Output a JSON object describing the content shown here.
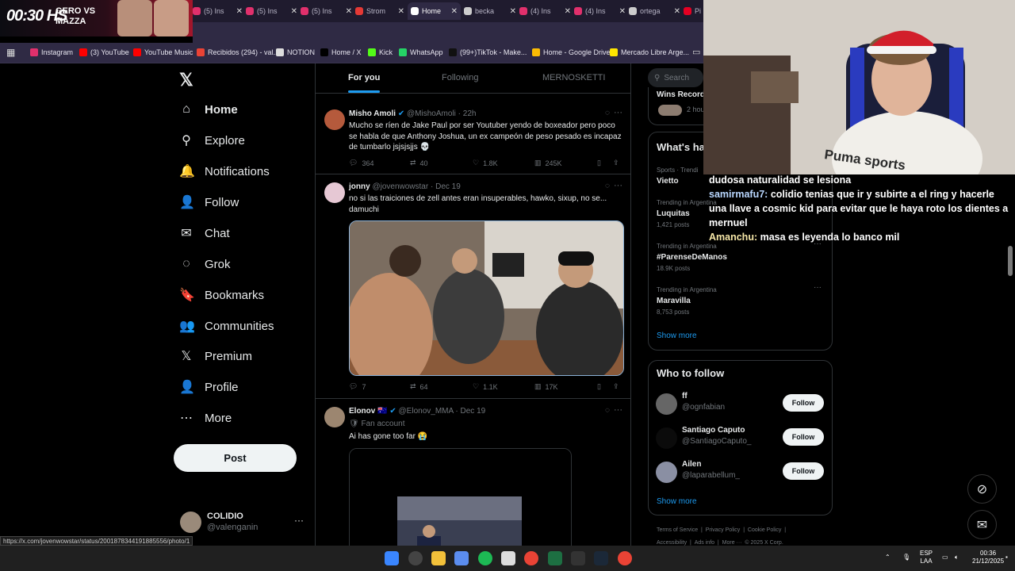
{
  "promo": {
    "clock": "00:30 HS",
    "line1": "GERO VS",
    "line2": "MAZZA"
  },
  "tabs": [
    {
      "label": "(5) Ins",
      "color": "#e1306c"
    },
    {
      "label": "(5) Ins",
      "color": "#e1306c"
    },
    {
      "label": "(5) Ins",
      "color": "#e1306c"
    },
    {
      "label": "Strom",
      "color": "#e53935"
    },
    {
      "label": "Home",
      "color": "#ffffff",
      "active": true
    },
    {
      "label": "becka",
      "color": "#cccccc"
    },
    {
      "label": "(4) Ins",
      "color": "#e1306c"
    },
    {
      "label": "(4) Ins",
      "color": "#e1306c"
    },
    {
      "label": "ortega",
      "color": "#cccccc"
    },
    {
      "label": "Pi",
      "color": "#e60023"
    }
  ],
  "bookmarks": [
    {
      "label": "Instagram",
      "color": "#e1306c"
    },
    {
      "label": "(3) YouTube",
      "color": "#ff0000"
    },
    {
      "label": "YouTube Music",
      "color": "#ff0000"
    },
    {
      "label": "Recibidos (294) - val...",
      "color": "#ea4335"
    },
    {
      "label": "NOTION",
      "color": "#dddddd"
    },
    {
      "label": "Home / X",
      "color": "#000000"
    },
    {
      "label": "Kick",
      "color": "#53fc18"
    },
    {
      "label": "WhatsApp",
      "color": "#25d366"
    },
    {
      "label": "(99+)TikTok - Make...",
      "color": "#111111"
    },
    {
      "label": "Home - Google Drive",
      "color": "#fbbc04"
    },
    {
      "label": "Mercado Libre Arge...",
      "color": "#ffe600"
    }
  ],
  "x_logo": "𝕏",
  "nav": [
    {
      "label": "Home",
      "icon": "house-icon",
      "glyph": "⌂"
    },
    {
      "label": "Explore",
      "icon": "search-icon",
      "glyph": "⚲"
    },
    {
      "label": "Notifications",
      "icon": "bell-icon",
      "glyph": "🔔"
    },
    {
      "label": "Follow",
      "icon": "person-plus-icon",
      "glyph": "👤"
    },
    {
      "label": "Chat",
      "icon": "mail-icon",
      "glyph": "✉"
    },
    {
      "label": "Grok",
      "icon": "grok-icon",
      "glyph": "◌"
    },
    {
      "label": "Bookmarks",
      "icon": "bookmark-icon",
      "glyph": "🔖"
    },
    {
      "label": "Communities",
      "icon": "communities-icon",
      "glyph": "👥"
    },
    {
      "label": "Premium",
      "icon": "x-premium-icon",
      "glyph": "𝕏"
    },
    {
      "label": "Profile",
      "icon": "profile-icon",
      "glyph": "👤"
    },
    {
      "label": "More",
      "icon": "more-icon",
      "glyph": "⋯"
    }
  ],
  "post_label": "Post",
  "account": {
    "name": "COLIDIO",
    "handle": "@valenganin",
    "dots": "···"
  },
  "status_url": "https://x.com/jovenwowstar/status/2001878344191885556/photo/1",
  "feed_tabs": [
    "For you",
    "Following",
    "MERNOSKETTI"
  ],
  "tweets": [
    {
      "name": "Misho Amoli",
      "verified": "✔",
      "handle": "@MishoAmoli",
      "time": "22h",
      "text": "Mucho se ríen de Jake Paul por ser Youtuber yendo de boxeador pero poco se habla de que Anthony Joshua, un ex campeón de peso pesado es incapaz de tumbarlo jsjsjsjjs 💀",
      "replies": "364",
      "reposts": "40",
      "likes": "1.8K",
      "views": "245K"
    },
    {
      "name": "jonny",
      "handle": "@jovenwowstar",
      "time": "Dec 19",
      "text": "no si las traiciones de zell antes eran insuperables, hawko, sixup, no se... damuchi",
      "replies": "7",
      "reposts": "64",
      "likes": "1.1K",
      "views": "17K"
    },
    {
      "name": "Elonov",
      "flag": "🇦🇺",
      "verified": "✔",
      "handle": "@Elonov_MMA",
      "time": "Dec 19",
      "badge": "🛡 Fan account",
      "text": "Ai has gone too far 😭"
    }
  ],
  "search_placeholder": "Search",
  "wins_record": {
    "label": "Wins Record",
    "time": "2 hou"
  },
  "whats_happening": "What's ha",
  "trends": [
    {
      "category": "Sports · Trendi",
      "name": "Vietto",
      "posts": ""
    },
    {
      "category": "Trending in Argentina",
      "name": "Luquitas",
      "posts": "1,421 posts"
    },
    {
      "category": "Trending in Argentina",
      "name": "#ParenseDeManos",
      "posts": "18.9K posts"
    },
    {
      "category": "Trending in Argentina",
      "name": "Maravilla",
      "posts": "8,753 posts"
    }
  ],
  "show_more": "Show more",
  "who_to_follow": "Who to follow",
  "suggestions": [
    {
      "name": "ff",
      "handle": "@ognfabian",
      "btn": "Follow"
    },
    {
      "name": "Santiago Caputo",
      "handle": "@SantiagoCaputo_",
      "btn": "Follow"
    },
    {
      "name": "Ailen",
      "handle": "@laparabellum_",
      "btn": "Follow"
    }
  ],
  "footer1": [
    "Terms of Service",
    "|",
    "Privacy Policy",
    "|",
    "Cookie Policy",
    "|"
  ],
  "footer2": [
    "Accessibility",
    "|",
    "Ads info",
    "|",
    "More ···",
    "© 2025 X Corp."
  ],
  "chat": [
    {
      "user": "",
      "msg": "dudosa naturalidad se lesiona"
    },
    {
      "user": "samirmafu7:",
      "msg": "colidio tenias que ir y subirte a el ring y hacerle una llave a cosmic kid para evitar que le haya roto los dientes a mernuel"
    },
    {
      "user": "Amanchu:",
      "msg": "masa es leyenda lo banco mil"
    }
  ],
  "cam_shirt": "Puma sports",
  "tray": {
    "lang1": "ESP",
    "lang2": "LAA",
    "time": "00:36",
    "date": "21/12/2025"
  }
}
